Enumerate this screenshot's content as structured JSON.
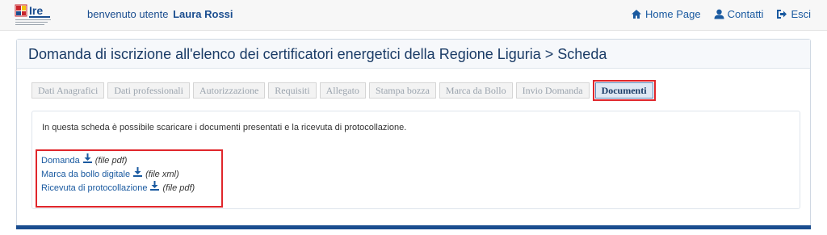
{
  "header": {
    "logo_text": "Ire",
    "welcome_text": "benvenuto utente",
    "user_name": "Laura Rossi",
    "nav": [
      {
        "label": "Home Page",
        "icon": "home-icon"
      },
      {
        "label": "Contatti",
        "icon": "user-icon"
      },
      {
        "label": "Esci",
        "icon": "logout-icon"
      }
    ]
  },
  "panel": {
    "title": "Domanda di iscrizione all'elenco dei certificatori energetici della Regione Liguria > Scheda"
  },
  "tabs": [
    {
      "label": "Dati Anagrafici"
    },
    {
      "label": "Dati professionali"
    },
    {
      "label": "Autorizzazione"
    },
    {
      "label": "Requisiti"
    },
    {
      "label": "Allegato"
    },
    {
      "label": "Stampa bozza"
    },
    {
      "label": "Marca da Bollo"
    },
    {
      "label": "Invio Domanda"
    },
    {
      "label": "Documenti",
      "active": true
    }
  ],
  "content": {
    "intro": "In questa scheda è possibile scaricare i documenti presentati e la ricevuta di protocollazione.",
    "documents": [
      {
        "label": "Domanda",
        "type": "(file pdf)",
        "icon": "download-icon"
      },
      {
        "label": "Marca da bollo digitale",
        "type": "(file xml)",
        "icon": "download-icon"
      },
      {
        "label": "Ricevuta di protocollazione",
        "type": "(file pdf)",
        "icon": "download-icon"
      }
    ]
  },
  "colors": {
    "accent": "#1a5aa0",
    "highlight": "#e0262b",
    "panel_bar": "#1a4d8f"
  }
}
